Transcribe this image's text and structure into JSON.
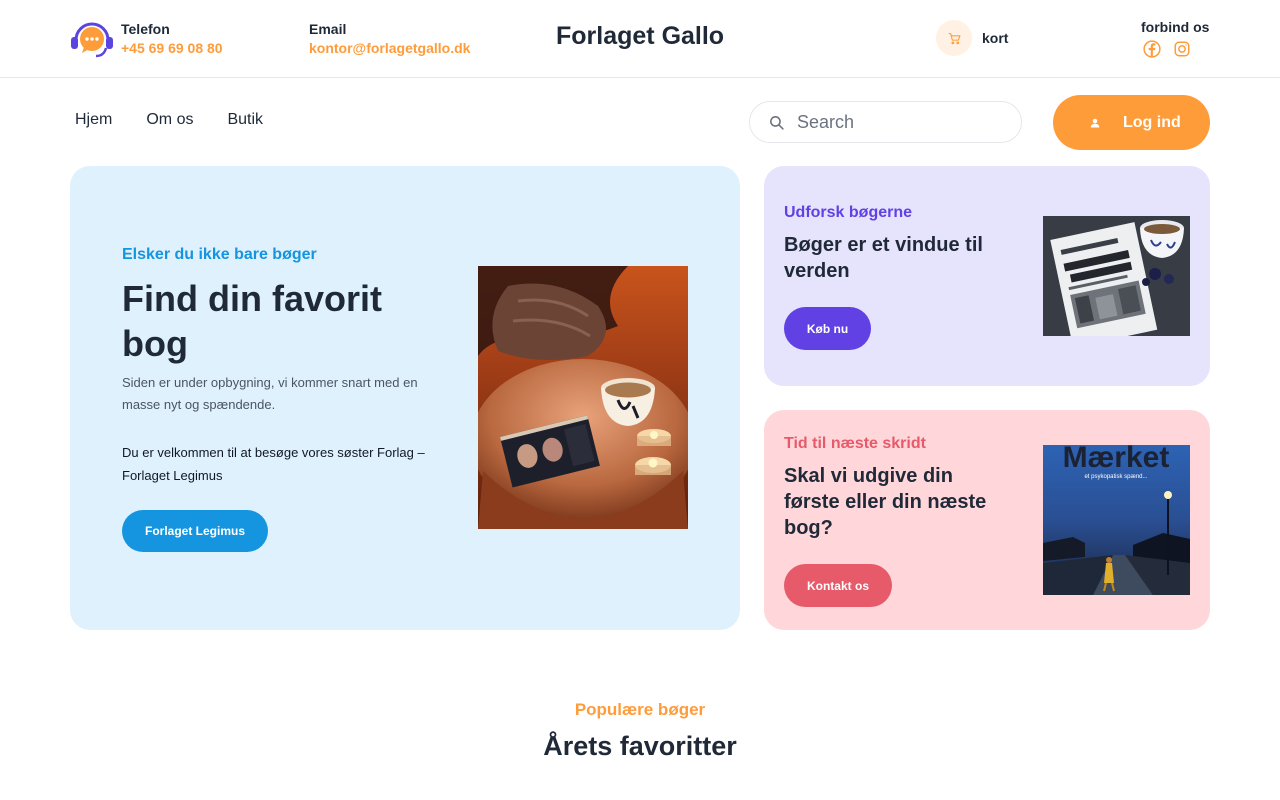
{
  "header": {
    "phone_label": "Telefon",
    "phone_value": "+45 69 69 08 80",
    "email_label": "Email",
    "email_value": "kontor@forlagetgallo.dk",
    "brand": "Forlaget Gallo",
    "cart_label": "kort",
    "social_label": "forbind os",
    "icons": [
      "support-chat-icon",
      "cart-icon",
      "facebook-icon",
      "instagram-icon"
    ]
  },
  "nav": {
    "items": [
      {
        "label": "Hjem"
      },
      {
        "label": "Om os"
      },
      {
        "label": "Butik"
      }
    ],
    "search_placeholder": "Search",
    "login_label": "Log ind"
  },
  "hero": {
    "eyebrow": "Elsker du ikke bare bøger",
    "title": "Find din favorit bog",
    "description": "Siden er under opbygning, vi kommer snart med en masse nyt og spændende.",
    "invite": "Du er velkommen til at besøge vores søster Forlag – Forlaget Legimus",
    "cta_label": "Forlaget Legimus"
  },
  "cards": [
    {
      "eyebrow": "Udforsk bøgerne",
      "title": "Bøger er et vindue til verden",
      "cta_label": "Køb nu"
    },
    {
      "eyebrow": "Tid til næste skridt",
      "title": "Skal vi udgive din første eller din næste bog?",
      "cta_label": "Kontakt os",
      "book_cover_title": "Mærket",
      "book_cover_subtitle": "et psykopatisk spænd..."
    }
  ],
  "section": {
    "eyebrow": "Populære bøger",
    "title": "Årets favoritter"
  },
  "colors": {
    "accent_orange": "#ff9c3a",
    "hero_bg": "#dff1fd",
    "hero_blue": "#1595df",
    "card_purple_bg": "#e6e3fd",
    "card_purple": "#6141e3",
    "card_pink_bg": "#ffd7da",
    "card_pink": "#e65a6a"
  }
}
